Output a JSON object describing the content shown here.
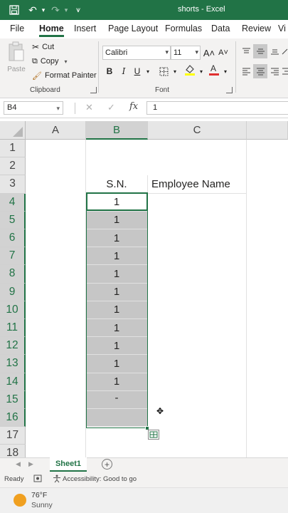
{
  "titlebar": {
    "title": "shorts  -  Excel",
    "save_icon": "💾",
    "undo_icon": "↶",
    "redo_icon": "↷",
    "dropdown_icon": "▾",
    "customize_icon": "⩛"
  },
  "tabs": [
    "File",
    "Home",
    "Insert",
    "Page Layout",
    "Formulas",
    "Data",
    "Review",
    "Vi"
  ],
  "active_tab": "Home",
  "ribbon": {
    "clipboard": {
      "paste": "Paste",
      "cut": "Cut",
      "copy": "Copy",
      "format_painter": "Format Painter",
      "label": "Clipboard"
    },
    "font": {
      "name": "Calibri",
      "size": "11",
      "grow": "A˄",
      "shrink": "A˅",
      "bold": "B",
      "italic": "I",
      "underline": "U",
      "label": "Font"
    }
  },
  "formula_bar": {
    "name_box": "B4",
    "cancel": "✕",
    "enter": "✓",
    "fx": "fx",
    "value": "1"
  },
  "columns": [
    "A",
    "B",
    "C"
  ],
  "rows": [
    "1",
    "2",
    "3",
    "4",
    "5",
    "6",
    "7",
    "8",
    "9",
    "10",
    "11",
    "12",
    "13",
    "14",
    "15",
    "16",
    "17",
    "18"
  ],
  "cells": {
    "B3": "S.N.",
    "C3": "Employee Name",
    "B4": "1",
    "B5": "1",
    "B6": "1",
    "B7": "1",
    "B8": "1",
    "B9": "1",
    "B10": "1",
    "B11": "1",
    "B12": "1",
    "B13": "1",
    "B14": "1",
    "B15": "-"
  },
  "sheets": [
    "Sheet1"
  ],
  "status": {
    "ready": "Ready",
    "accessibility": "Accessibility: Good to go"
  },
  "weather": {
    "temp": "76°F",
    "condition": "Sunny"
  },
  "colors": {
    "accent": "#217346",
    "selection_fill": "#c6c6c6"
  }
}
